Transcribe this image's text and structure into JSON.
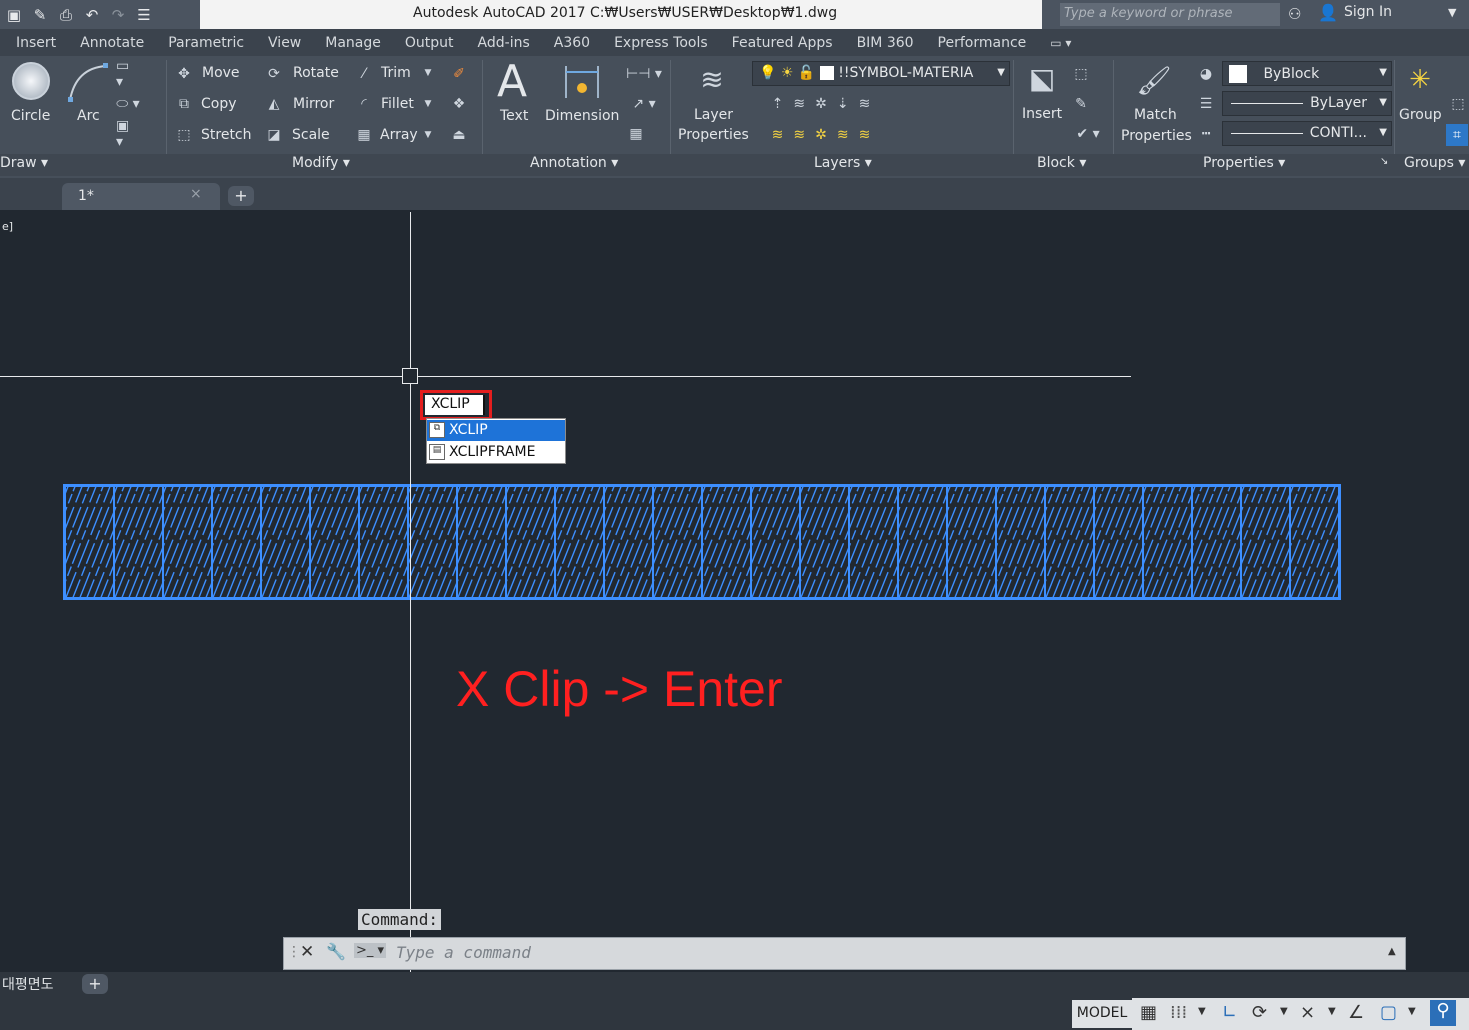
{
  "window": {
    "title": "Autodesk AutoCAD 2017     C:₩Users₩USER₩Desktop₩1.dwg",
    "search_placeholder": "Type a keyword or phrase",
    "sign_in": "Sign In"
  },
  "ribbon_tabs": [
    "Insert",
    "Annotate",
    "Parametric",
    "View",
    "Manage",
    "Output",
    "Add-ins",
    "A360",
    "Express Tools",
    "Featured Apps",
    "BIM 360",
    "Performance"
  ],
  "draw": {
    "circle": "Circle",
    "arc": "Arc",
    "panel": "Draw ▾"
  },
  "modify": {
    "move": "Move",
    "rotate": "Rotate",
    "trim": "Trim",
    "copy": "Copy",
    "mirror": "Mirror",
    "fillet": "Fillet",
    "stretch": "Stretch",
    "scale": "Scale",
    "array": "Array",
    "panel": "Modify ▾"
  },
  "annotation": {
    "text": "Text",
    "dimension": "Dimension",
    "panel": "Annotation ▾"
  },
  "layers": {
    "layer_properties_1": "Layer",
    "layer_properties_2": "Properties",
    "current_layer": "!!SYMBOL-MATERIA",
    "panel": "Layers ▾"
  },
  "block": {
    "insert": "Insert",
    "panel": "Block ▾"
  },
  "properties": {
    "match_1": "Match",
    "match_2": "Properties",
    "color": "ByBlock",
    "lineweight": "ByLayer",
    "linetype": "CONTI...",
    "panel": "Properties ▾"
  },
  "groups": {
    "group": "Group",
    "panel": "Groups ▾"
  },
  "file_tab": {
    "name": "1*",
    "close": "×",
    "new": "+"
  },
  "canvas": {
    "viewport_label": "e]",
    "dyn_input": "XCLIP",
    "autocomplete": [
      "XCLIP",
      "XCLIPFRAME"
    ],
    "annotation": "X Clip -> Enter",
    "hatch_cells": 26,
    "colors": {
      "hatch": "#3d8fff",
      "annotation": "#ff2020",
      "highlight": "#e41e1e"
    }
  },
  "command": {
    "label": "Command:",
    "placeholder": "Type a command"
  },
  "layout_tabs": {
    "name": "대평면도",
    "add": "+"
  },
  "status": {
    "model": "MODEL"
  }
}
